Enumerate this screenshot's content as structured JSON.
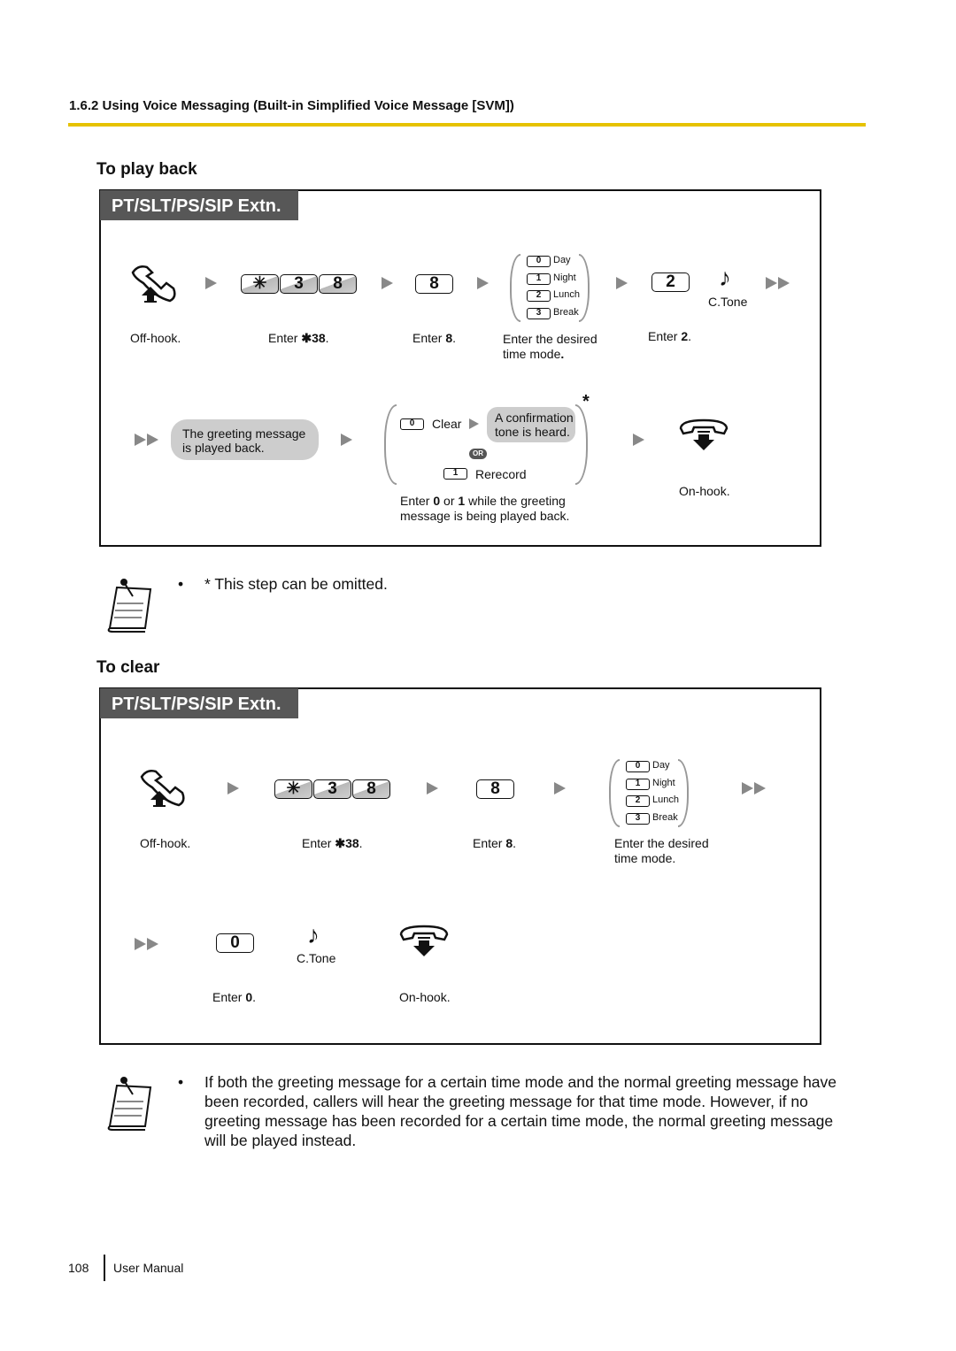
{
  "header": {
    "title": "1.6.2 Using Voice Messaging (Built-in Simplified Voice Message [SVM])"
  },
  "colors": {
    "rule": "#e6c200",
    "tab": "#575757",
    "bubble": "#cdcdcd"
  },
  "playback": {
    "title": "To play back",
    "tab": "PT/SLT/PS/SIP Extn.",
    "keys": {
      "star": "✳",
      "k3": "3",
      "k8": "8",
      "k8b": "8",
      "k2": "2",
      "k0": "0",
      "k1": "1"
    },
    "modes": [
      {
        "key": "0",
        "label": "Day"
      },
      {
        "key": "1",
        "label": "Night"
      },
      {
        "key": "2",
        "label": "Lunch"
      },
      {
        "key": "3",
        "label": "Break"
      }
    ],
    "ctone": "C.Tone",
    "labels": {
      "offhook": "Off-hook.",
      "enter_star38_pre": "Enter ",
      "enter_star38_b": "✱38",
      "dot": ".",
      "enter8_pre": "Enter ",
      "enter8_b": "8",
      "mode1": "Enter the desired",
      "mode2": "time mode",
      "enter2_pre": "Enter ",
      "enter2_b": "2",
      "onhook": "On-hook."
    },
    "greeting_bubble": [
      "The greeting message",
      "is played back."
    ],
    "clear": "Clear",
    "rerecord": "Rerecord",
    "or": "OR",
    "asterisk": "*",
    "confirm_bubble": [
      "A confirmation",
      "tone is heard."
    ],
    "enter01": {
      "p1": "Enter ",
      "b1": "0",
      "p2": " or ",
      "b2": "1",
      "p3": " while the greeting",
      "line2": "message is being played back."
    }
  },
  "note1": {
    "bullet": "•",
    "text": "* This step can be omitted."
  },
  "clear": {
    "title": "To clear",
    "tab": "PT/SLT/PS/SIP Extn.",
    "keys": {
      "star": "✳",
      "k3": "3",
      "k8": "8",
      "k8b": "8",
      "k0": "0"
    },
    "modes": [
      {
        "key": "0",
        "label": "Day"
      },
      {
        "key": "1",
        "label": "Night"
      },
      {
        "key": "2",
        "label": "Lunch"
      },
      {
        "key": "3",
        "label": "Break"
      }
    ],
    "ctone": "C.Tone",
    "labels": {
      "offhook": "Off-hook.",
      "enter_pre": "Enter ",
      "star38": "✱38",
      "dot": ".",
      "enter8": "8",
      "mode1": "Enter the desired",
      "mode2": "time mode.",
      "enter0": "0",
      "onhook": "On-hook."
    }
  },
  "note2": {
    "bullet": "•",
    "lines": [
      "If both the greeting message for a certain time mode and the normal greeting message have",
      "been recorded, callers will hear the greeting message for that time mode. However, if no",
      "greeting message has been recorded for a certain time mode, the normal greeting message",
      "will be played instead."
    ]
  },
  "footer": {
    "page": "108",
    "label": "User Manual"
  }
}
